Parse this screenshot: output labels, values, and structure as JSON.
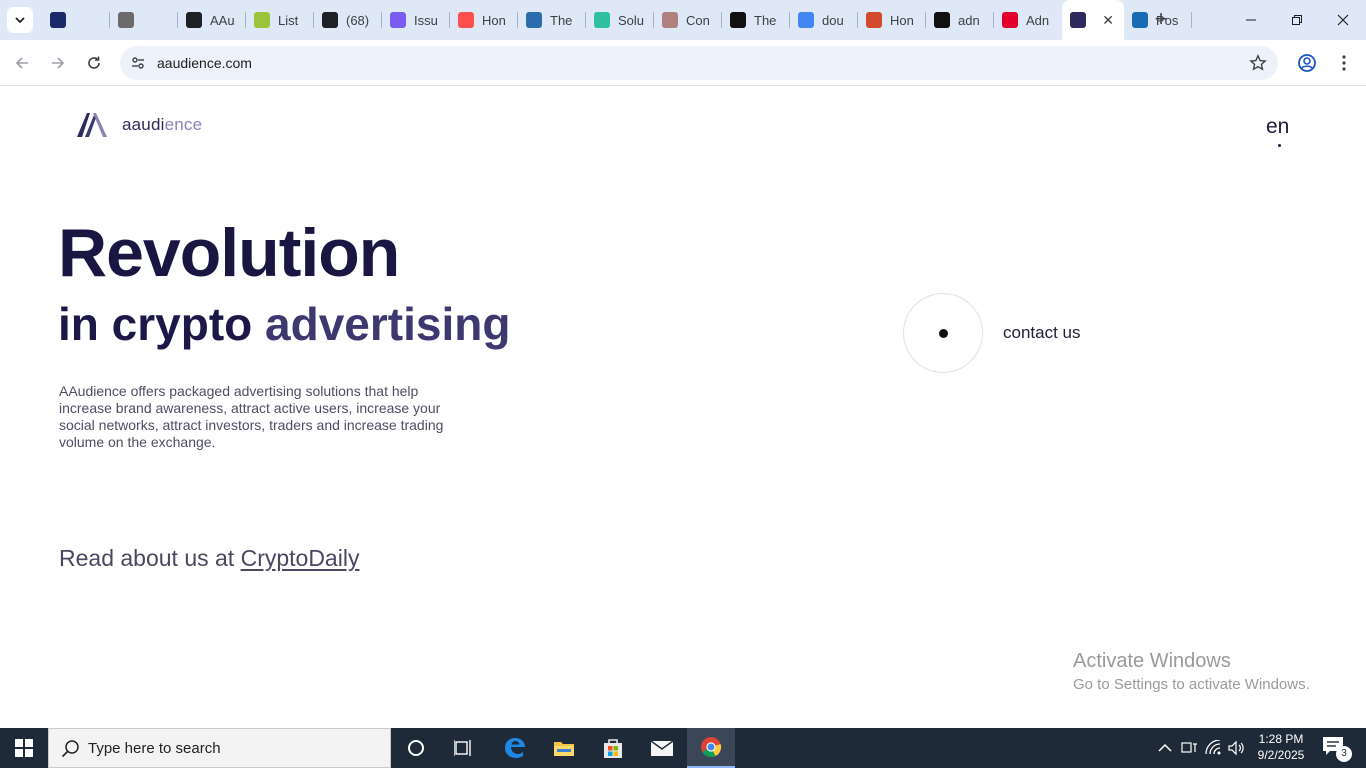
{
  "browser": {
    "tabs": [
      {
        "title": "",
        "favicon": "stack-icon",
        "color": "#1a2a6b"
      },
      {
        "title": "",
        "favicon": "fx-exchange-icon",
        "color": "#6b6b6b"
      },
      {
        "title": "AAu",
        "favicon": "openai-icon",
        "color": "#202124"
      },
      {
        "title": "List",
        "favicon": "w-icon",
        "color": "#9ac43c"
      },
      {
        "title": "(68)",
        "favicon": "b-icon",
        "color": "#202124"
      },
      {
        "title": "Issu",
        "favicon": "e-icon",
        "color": "#7b5cf0"
      },
      {
        "title": "Hon",
        "favicon": "f-icon",
        "color": "#ff4f4f"
      },
      {
        "title": "The",
        "favicon": "p-icon",
        "color": "#2b6cb0"
      },
      {
        "title": "Solu",
        "favicon": "swirl-icon",
        "color": "#30c0a0"
      },
      {
        "title": "Con",
        "favicon": "circle-icon",
        "color": "#b08080"
      },
      {
        "title": "The",
        "favicon": "slash-icon",
        "color": "#111111"
      },
      {
        "title": "dou",
        "favicon": "google-icon",
        "color": "#4285f4"
      },
      {
        "title": "Hon",
        "favicon": "c-icon",
        "color": "#d24a2b"
      },
      {
        "title": "adn",
        "favicon": "ad-icon",
        "color": "#111111"
      },
      {
        "title": "Adn",
        "favicon": "a-red-icon",
        "color": "#e4002b"
      },
      {
        "title": "",
        "favicon": "aaudience-icon",
        "color": "#2e2a5e"
      },
      {
        "title": "Pos",
        "favicon": "xf-icon",
        "color": "#1a6bb5"
      }
    ],
    "url": "aaudience.com"
  },
  "page": {
    "logo": {
      "brand_dark": "aaudi",
      "brand_light": "ence"
    },
    "language": "en",
    "hero": {
      "title": "Revolution",
      "subtitle_part1": "in crypto ",
      "subtitle_part2": "advertising",
      "description": "AAudience offers packaged advertising solutions that help increase brand awareness, attract active users, increase your social networks, attract investors, traders and increase trading volume on the exchange."
    },
    "read_about": {
      "prefix": "Read about us at ",
      "link": "CryptoDaily"
    },
    "contact": {
      "label": "contact us"
    },
    "activation": {
      "line1": "Activate Windows",
      "line2": "Go to Settings to activate Windows."
    }
  },
  "taskbar": {
    "search_placeholder": "Type here to search",
    "time": "1:28 PM",
    "date": "9/2/2025",
    "notifications": "3"
  }
}
